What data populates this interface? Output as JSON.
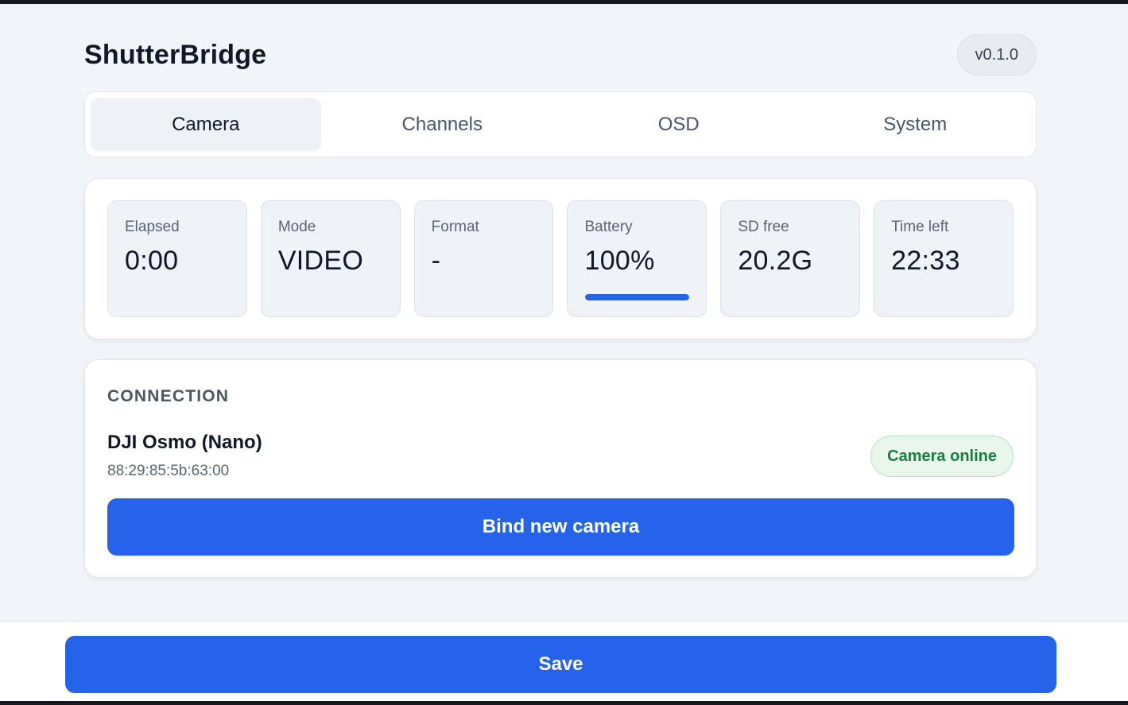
{
  "header": {
    "title": "ShutterBridge",
    "version": "v0.1.0"
  },
  "tabs": [
    {
      "label": "Camera",
      "active": true
    },
    {
      "label": "Channels",
      "active": false
    },
    {
      "label": "OSD",
      "active": false
    },
    {
      "label": "System",
      "active": false
    }
  ],
  "stats": {
    "elapsed": {
      "label": "Elapsed",
      "value": "0:00"
    },
    "mode": {
      "label": "Mode",
      "value": "VIDEO"
    },
    "format": {
      "label": "Format",
      "value": "-"
    },
    "battery": {
      "label": "Battery",
      "value": "100%",
      "level": 1.0
    },
    "sd_free": {
      "label": "SD free",
      "value": "20.2G"
    },
    "time_left": {
      "label": "Time left",
      "value": "22:33"
    }
  },
  "connection": {
    "title": "CONNECTION",
    "device_name": "DJI Osmo (Nano)",
    "device_mac": "88:29:85:5b:63:00",
    "status": "Camera online",
    "bind_label": "Bind new camera"
  },
  "footer": {
    "save_label": "Save"
  },
  "colors": {
    "accent": "#2563eb",
    "online": "#15803d",
    "online_bg": "#e8f6ec"
  }
}
